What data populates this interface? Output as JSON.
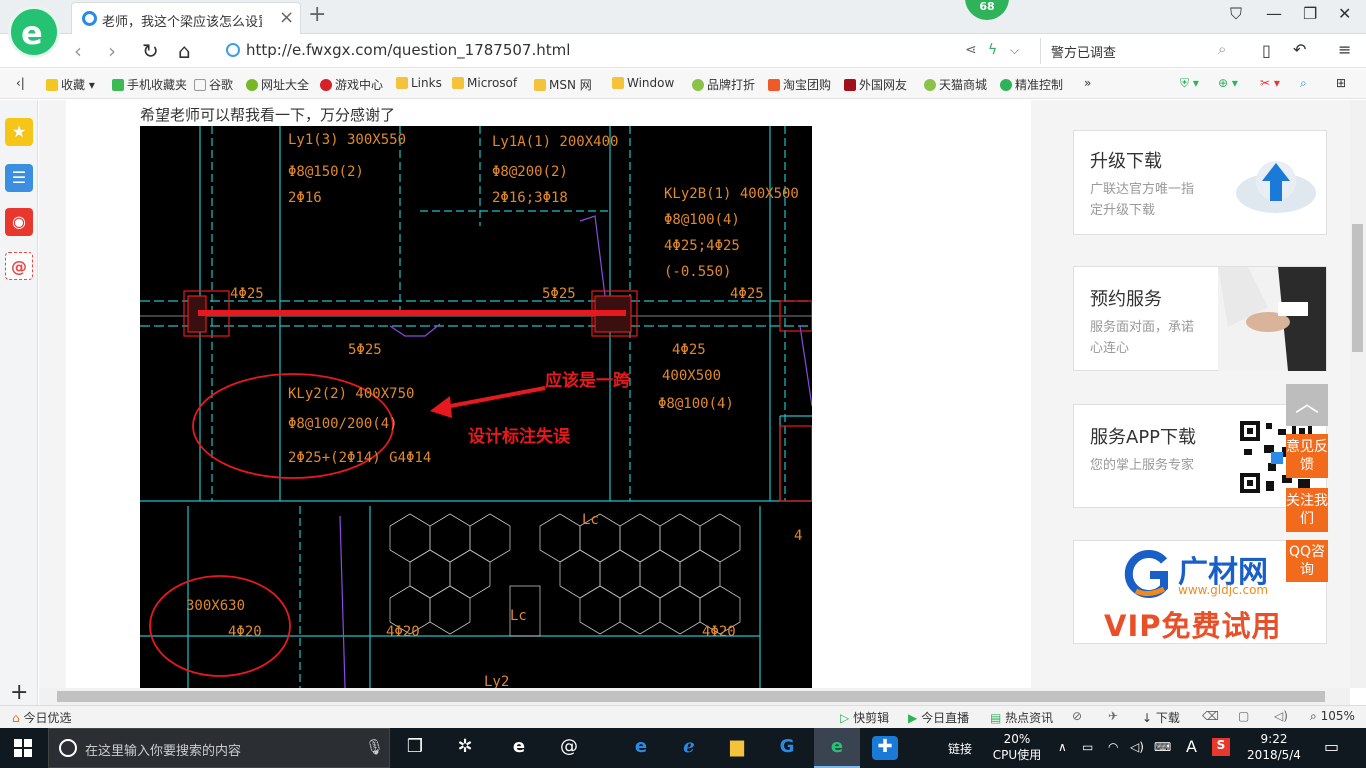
{
  "browser": {
    "tab_title": "老师，我这个梁应该怎么设置_广联达服务新干线",
    "badge": "68",
    "url": "http://e.fwxgx.com/question_1787507.html",
    "search_query": "警方已调查"
  },
  "bookmarks": [
    "收藏",
    "手机收藏夹",
    "谷歌",
    "网址大全",
    "游戏中心",
    "Links",
    "Microsof",
    "MSN 网",
    "Window",
    "品牌打折",
    "淘宝团购",
    "外国网友",
    "天猫商城",
    "精准控制"
  ],
  "article": {
    "question_text": "希望老师可以帮我看一下，万分感谢了"
  },
  "cad": {
    "texts": [
      {
        "t": "Ly1(3) 300X550",
        "c": "o"
      },
      {
        "t": "Φ8@150(2)",
        "c": "o"
      },
      {
        "t": "2Φ16",
        "c": "o"
      },
      {
        "t": "Ly1A(1) 200X400",
        "c": "o"
      },
      {
        "t": "Φ8@200(2)",
        "c": "o"
      },
      {
        "t": "2Φ16;3Φ18",
        "c": "o"
      },
      {
        "t": "KLy2B(1) 400X500",
        "c": "o"
      },
      {
        "t": "Φ8@100(4)",
        "c": "o"
      },
      {
        "t": "4Φ25;4Φ25",
        "c": "o"
      },
      {
        "t": "(-0.550)",
        "c": "o"
      },
      {
        "t": "4Φ25",
        "c": "o"
      },
      {
        "t": "5Φ25",
        "c": "o"
      },
      {
        "t": "4Φ25",
        "c": "o"
      },
      {
        "t": "5Φ25",
        "c": "o"
      },
      {
        "t": "4Φ25",
        "c": "o"
      },
      {
        "t": "400X500",
        "c": "o"
      },
      {
        "t": "Φ8@100(4)",
        "c": "o"
      },
      {
        "t": "KLy2(2) 400X750",
        "c": "o"
      },
      {
        "t": "Φ8@100/200(4)",
        "c": "o"
      },
      {
        "t": "2Φ25+(2Φ14) G4Φ14",
        "c": "o"
      },
      {
        "t": "300X630",
        "c": "o"
      },
      {
        "t": "4Φ20",
        "c": "o"
      },
      {
        "t": "4Φ20",
        "c": "o"
      },
      {
        "t": "4Φ20",
        "c": "o"
      },
      {
        "t": "Lc",
        "c": "o"
      },
      {
        "t": "Lc",
        "c": "o"
      },
      {
        "t": "4",
        "c": "o"
      },
      {
        "t": "Ly2",
        "c": "o"
      }
    ],
    "annotation_1": "应该是一跨",
    "annotation_2": "设计标注失误"
  },
  "sidebar": {
    "cards": [
      {
        "title": "升级下载",
        "desc": "广联达官方唯一指定升级下载"
      },
      {
        "title": "预约服务",
        "desc": "服务面对面，承诺心连心"
      },
      {
        "title": "服务APP下载",
        "desc": "您的掌上服务专家"
      }
    ],
    "ad": {
      "brand": "广材网",
      "domain": "www.gldjc.com",
      "slogan": "VIP免费试用"
    },
    "float_buttons": [
      "意见反馈",
      "关注我们",
      "QQ咨询"
    ]
  },
  "statusbar": {
    "left": "今日优选",
    "items": [
      "快剪辑",
      "今日直播",
      "热点资讯",
      "下载"
    ],
    "zoom": "105%"
  },
  "taskbar": {
    "search_placeholder": "在这里输入你要搜索的内容",
    "tray_link": "链接",
    "cpu_percent": "20%",
    "cpu_label": "CPU使用",
    "ime": "A",
    "time": "9:22",
    "date": "2018/5/4"
  },
  "colors": {
    "cad_bg": "#000000",
    "cad_orange": "#e0882c",
    "cad_cyan": "#20c0c8",
    "annotation_red": "#e8191e",
    "accent_orange": "#f26b1d",
    "browser_green": "#24c272"
  }
}
